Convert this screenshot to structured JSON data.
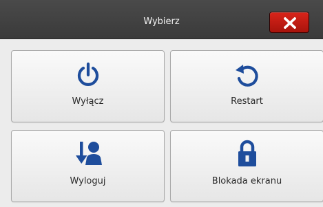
{
  "window": {
    "title": "Wybierz",
    "accent_color": "#1e4d9c",
    "close_color": "#c01a10"
  },
  "options": [
    {
      "label": "Wyłącz",
      "icon": "power-icon"
    },
    {
      "label": "Restart",
      "icon": "restart-icon"
    },
    {
      "label": "Wyloguj",
      "icon": "logout-icon"
    },
    {
      "label": "Blokada ekranu",
      "icon": "lock-icon"
    }
  ]
}
